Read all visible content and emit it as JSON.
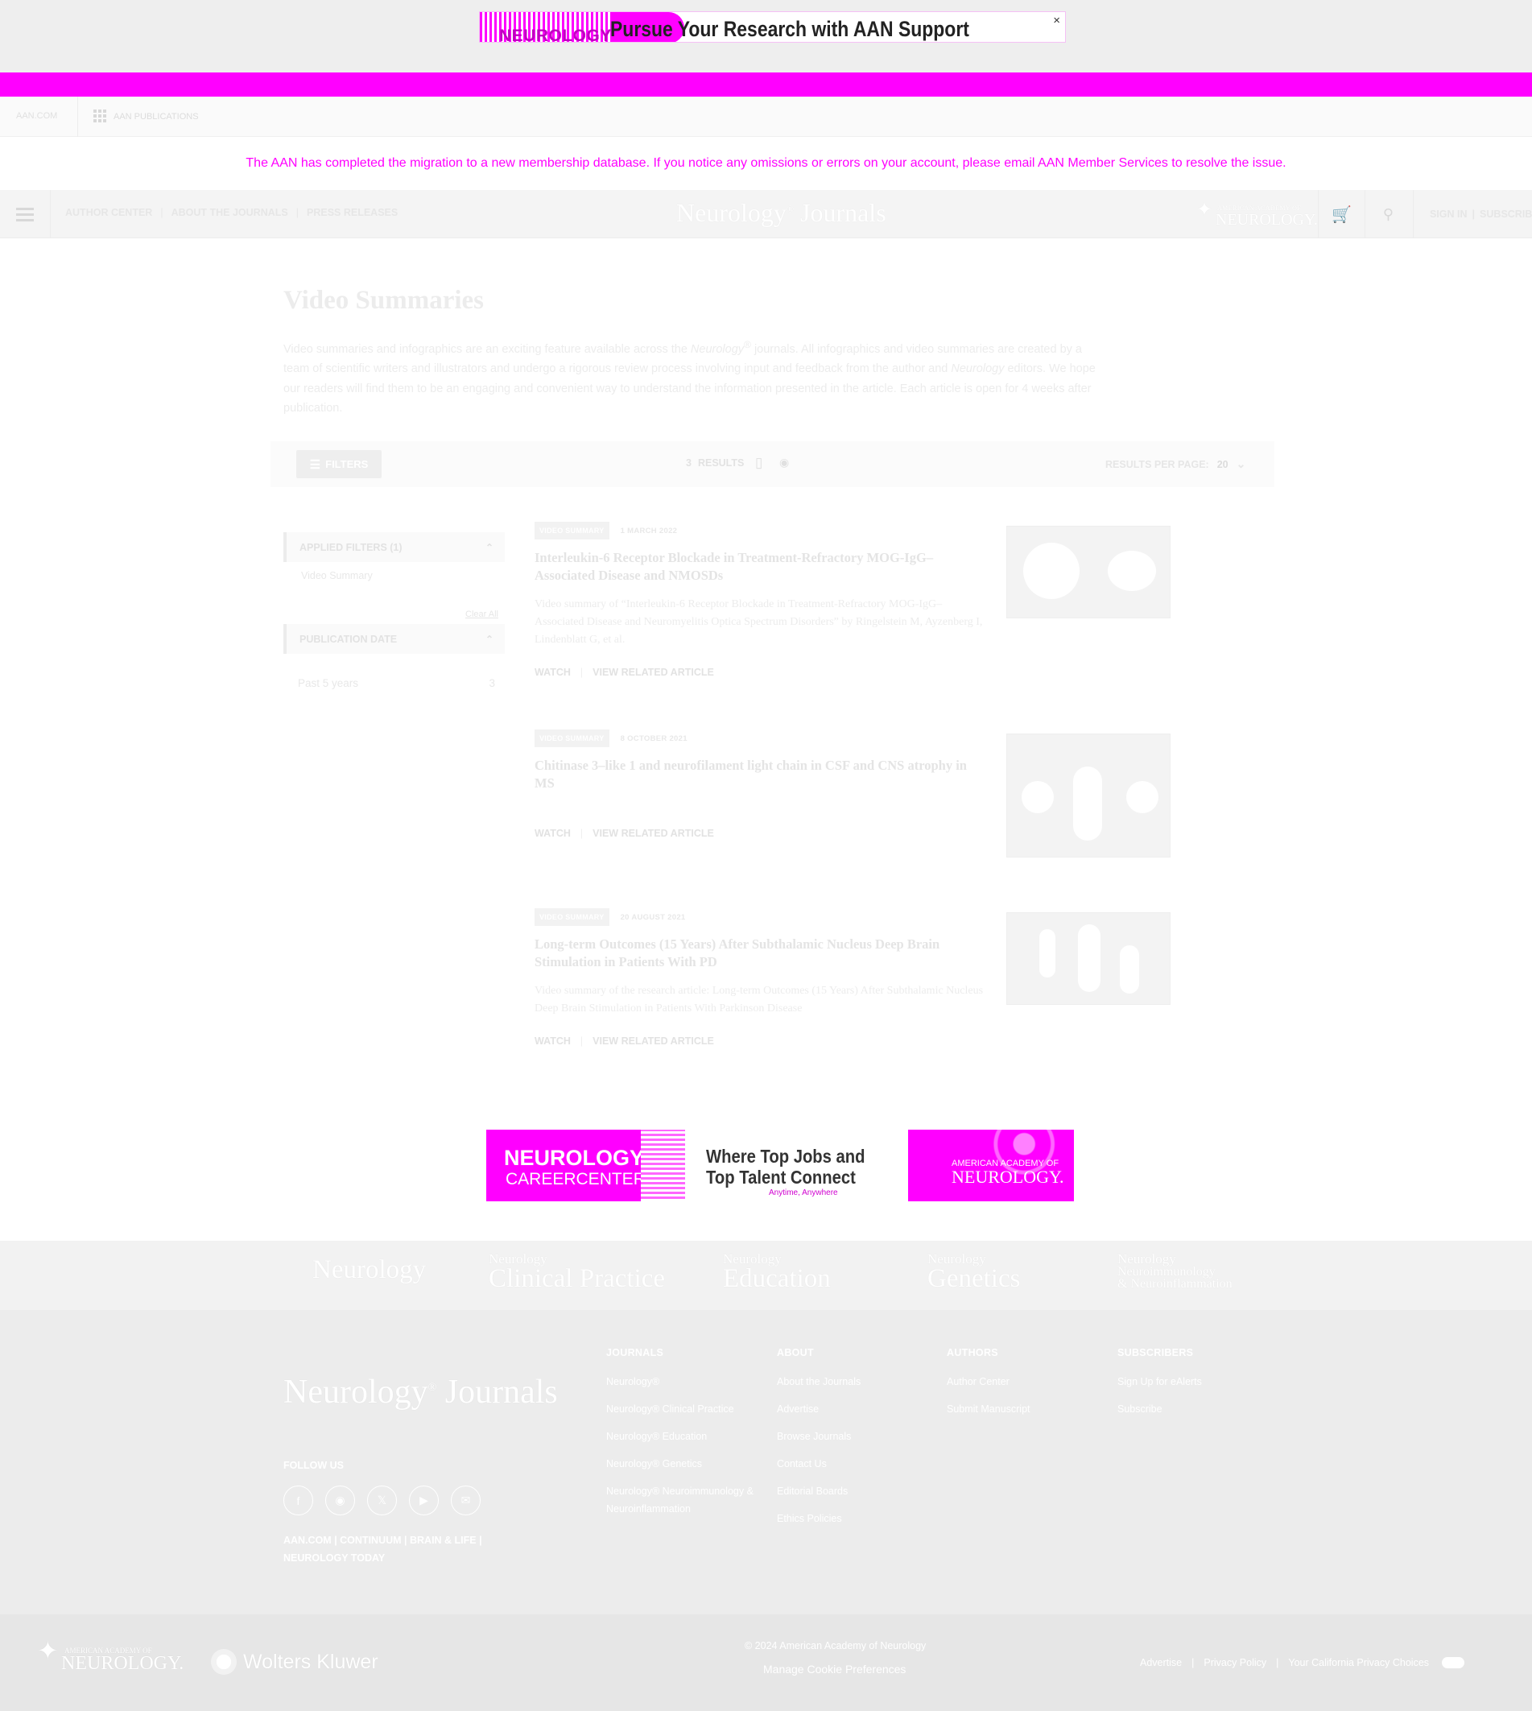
{
  "top_ad": {
    "logo_text": "NEUROLOGY",
    "headline": "Pursue Your Research with AAN Support",
    "subtext": "",
    "close_label": "×"
  },
  "utility_bar": {
    "aan_link": "AAN.COM",
    "publications_label": "AAN PUBLICATIONS",
    "grid_icon": "apps-grid-icon"
  },
  "notice": {
    "text": "The AAN has completed the migration to a new membership database. If you notice any omissions or errors on your account, please email AAN Member Services to resolve the issue."
  },
  "header": {
    "nav": [
      {
        "label": "AUTHOR CENTER"
      },
      {
        "label": "ABOUT THE JOURNALS"
      },
      {
        "label": "PRESS RELEASES"
      }
    ],
    "nav_separator": "|",
    "brand": "Neurology",
    "brand_mark": "®",
    "brand_suffix": " Journals",
    "aan_logo_small": "AMERICAN ACADEMY OF",
    "aan_logo_big": "NEUROLOGY.",
    "cart_icon": "cart-icon",
    "search_icon": "search-icon",
    "sign_in": "SIGN IN",
    "subscribe": "SUBSCRIBE",
    "account_separator": "|"
  },
  "page": {
    "title": "Video Summaries",
    "intro_part1": "Video summaries and infographics are an exciting feature available across the ",
    "intro_italic1": "Neurology",
    "intro_mark": "®",
    "intro_part2": " journals. All infographics and video summaries are created by a team of scientific writers and illustrators and undergo a rigorous review process involving input and feedback from the author and ",
    "intro_italic2": "Neurology",
    "intro_part3": " editors. We hope our readers will find them to be an engaging and convenient way to understand the information presented in the article. Each article is open for 4 weeks after publication."
  },
  "toolbar": {
    "filters_label": "FILTERS",
    "results_count": "3",
    "results_label": "RESULTS",
    "per_page_label": "RESULTS PER PAGE:",
    "per_page_value": "20"
  },
  "sidebar": {
    "applied_filters_label": "APPLIED FILTERS (1)",
    "applied_filter_item": "Video Summary",
    "clear_all": "Clear All",
    "publication_date_label": "PUBLICATION DATE",
    "date_option": "Past 5 years",
    "date_option_count": "3"
  },
  "results": [
    {
      "badge": "VIDEO SUMMARY",
      "date": "1 MARCH 2022",
      "title": "Interleukin-6 Receptor Blockade in Treatment-Refractory MOG-IgG–Associated Disease and NMOSDs",
      "description": "Video summary of “Interleukin-6 Receptor Blockade in Treatment-Refractory MOG-IgG–Associated Disease and Neuromyelitis Optica Spectrum Disorders” by Ringelstein M, Ayzenberg I, Lindenblatt G, et al.",
      "watch": "WATCH",
      "related": "VIEW RELATED ARTICLE"
    },
    {
      "badge": "VIDEO SUMMARY",
      "date": "8 OCTOBER 2021",
      "title": "Chitinase 3–like 1 and neurofilament light chain in CSF and CNS atrophy in MS",
      "description": "",
      "watch": "WATCH",
      "related": "VIEW RELATED ARTICLE"
    },
    {
      "badge": "VIDEO SUMMARY",
      "date": "20 AUGUST 2021",
      "title": "Long-term Outcomes (15 Years) After Subthalamic Nucleus Deep Brain Stimulation in Patients With PD",
      "description": "Video summary of the research article: Long-term Outcomes (15 Years) After Subthalamic Nucleus Deep Brain Stimulation in Patients With Parkinson Disease",
      "watch": "WATCH",
      "related": "VIEW RELATED ARTICLE"
    }
  ],
  "bottom_ads": {
    "career_line1": "NEUROLOGY",
    "career_line2": "CAREERCENTER",
    "talent_line1": "Where Top Jobs and",
    "talent_line2": "Top Talent Connect",
    "talent_line3": "Anytime, Anywhere",
    "aan_small": "AMERICAN ACADEMY OF",
    "aan_big": "NEUROLOGY."
  },
  "journals_strip": [
    {
      "top": "",
      "main": "Neurology",
      "extra": ""
    },
    {
      "top": "Neurology",
      "main": "Clinical Practice",
      "extra": ""
    },
    {
      "top": "Neurology",
      "main": "Education",
      "extra": ""
    },
    {
      "top": "Neurology",
      "main": "Genetics",
      "extra": ""
    },
    {
      "top": "Neurology",
      "main": "Neuroimmunology",
      "extra": "& Neuroinflammation"
    }
  ],
  "footer": {
    "brand": "Neurology",
    "brand_mark": "®",
    "brand_suffix": " Journals",
    "follow_us": "FOLLOW US",
    "socials": [
      "f",
      "◉",
      "𝕏",
      "▶",
      "✉"
    ],
    "links_line1": "AAN.COM  |  CONTINUUM  |  BRAIN & LIFE  |",
    "links_line2": "NEUROLOGY TODAY",
    "columns": [
      {
        "heading": "JOURNALS",
        "items": [
          "Neurology®",
          "Neurology® Clinical Practice",
          "Neurology® Education",
          "Neurology® Genetics",
          "Neurology® Neuroimmunology & Neuroinflammation"
        ]
      },
      {
        "heading": "ABOUT",
        "items": [
          "About the Journals",
          "Advertise",
          "Browse Journals",
          "Contact Us",
          "Editorial Boards",
          "Ethics Policies"
        ]
      },
      {
        "heading": "AUTHORS",
        "items": [
          "Author Center",
          "Submit Manuscript"
        ]
      },
      {
        "heading": "SUBSCRIBERS",
        "items": [
          "Sign Up for eAlerts",
          "Subscribe"
        ]
      }
    ]
  },
  "bottom_bar": {
    "aan_small": "AMERICAN ACADEMY OF",
    "aan_big": "NEUROLOGY.",
    "wk_name": "Wolters Kluwer",
    "copyright": "© 2024 American Academy of Neurology",
    "cookie": "Manage Cookie Preferences",
    "advertise": "Advertise",
    "privacy": "Privacy Policy",
    "california": "Your California Privacy Choices"
  }
}
